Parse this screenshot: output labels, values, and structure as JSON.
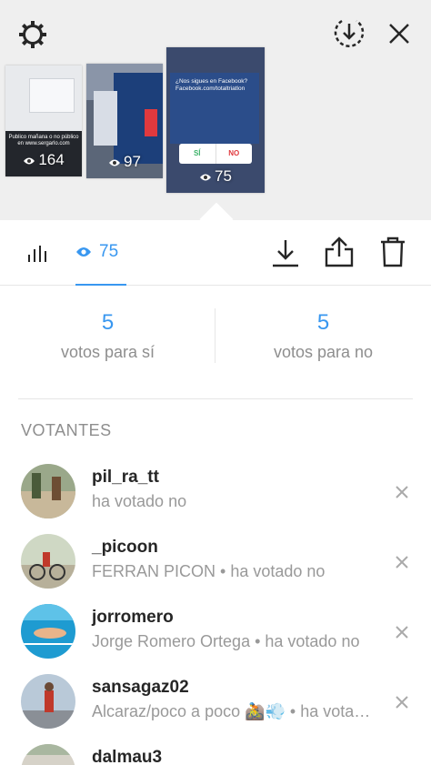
{
  "header": {
    "icons": {
      "settings": "gear-icon",
      "save": "download-circle-icon",
      "close": "close-icon"
    }
  },
  "stories": [
    {
      "views": "164",
      "caption": "Publico mañana o no público en www.sergarlo.com"
    },
    {
      "views": "97"
    },
    {
      "views": "75",
      "caption": "¿Nos sigues en Facebook? Facebook.com/totaltriatlon",
      "poll_yes": "SÍ",
      "poll_no": "NO"
    }
  ],
  "toolbar": {
    "viewers_count": "75",
    "icons": [
      "bar-chart-icon",
      "eye-icon",
      "download-icon",
      "share-icon",
      "trash-icon"
    ]
  },
  "poll": {
    "yes_count": "5",
    "yes_label": "votos para sí",
    "no_count": "5",
    "no_label": "votos para no"
  },
  "voters": {
    "title": "VOTANTES",
    "items": [
      {
        "username": "pil_ra_tt",
        "detail": "ha votado no"
      },
      {
        "username": "_picoon",
        "detail": "FERRAN PICON • ha votado no"
      },
      {
        "username": "jorromero",
        "detail": "Jorge Romero Ortega • ha votado no"
      },
      {
        "username": "sansagaz02",
        "detail": "Alcaraz/poco a poco 🚵💨 • ha votado no"
      },
      {
        "username": "dalmau3",
        "detail": ""
      }
    ]
  },
  "colors": {
    "accent": "#3897f0",
    "muted": "#8e8e8e",
    "top_bg": "#efefef"
  }
}
